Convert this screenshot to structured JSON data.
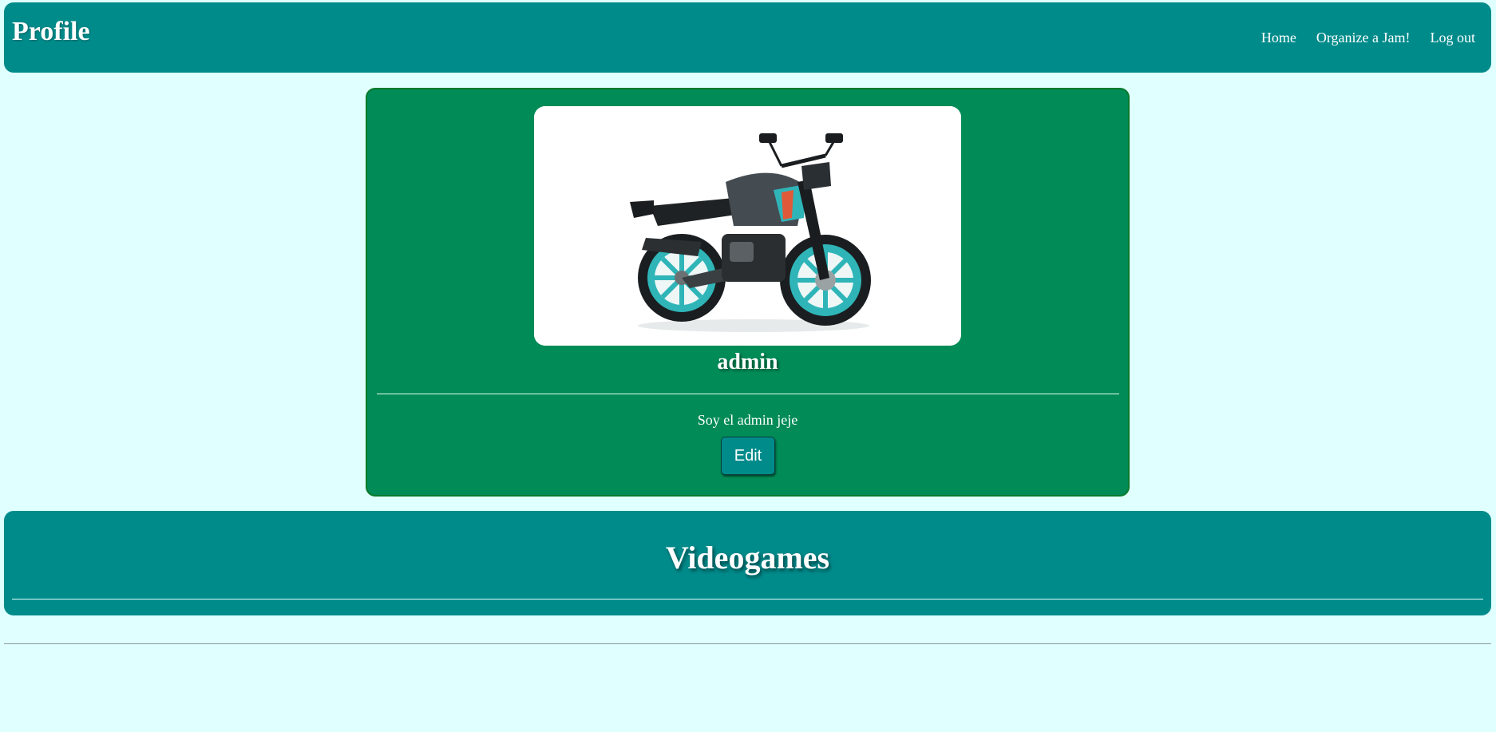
{
  "header": {
    "title": "Profile",
    "nav": {
      "home": "Home",
      "organize": "Organize a Jam!",
      "logout": "Log out"
    }
  },
  "profile": {
    "username": "admin",
    "bio": "Soy el admin jeje",
    "edit_label": "Edit",
    "avatar_subject": "motorcycle-photo"
  },
  "videogames": {
    "title": "Videogames"
  },
  "colors": {
    "background": "#e0ffff",
    "header": "#008b8b",
    "profile_card": "#008b57",
    "text": "#ffffff"
  }
}
